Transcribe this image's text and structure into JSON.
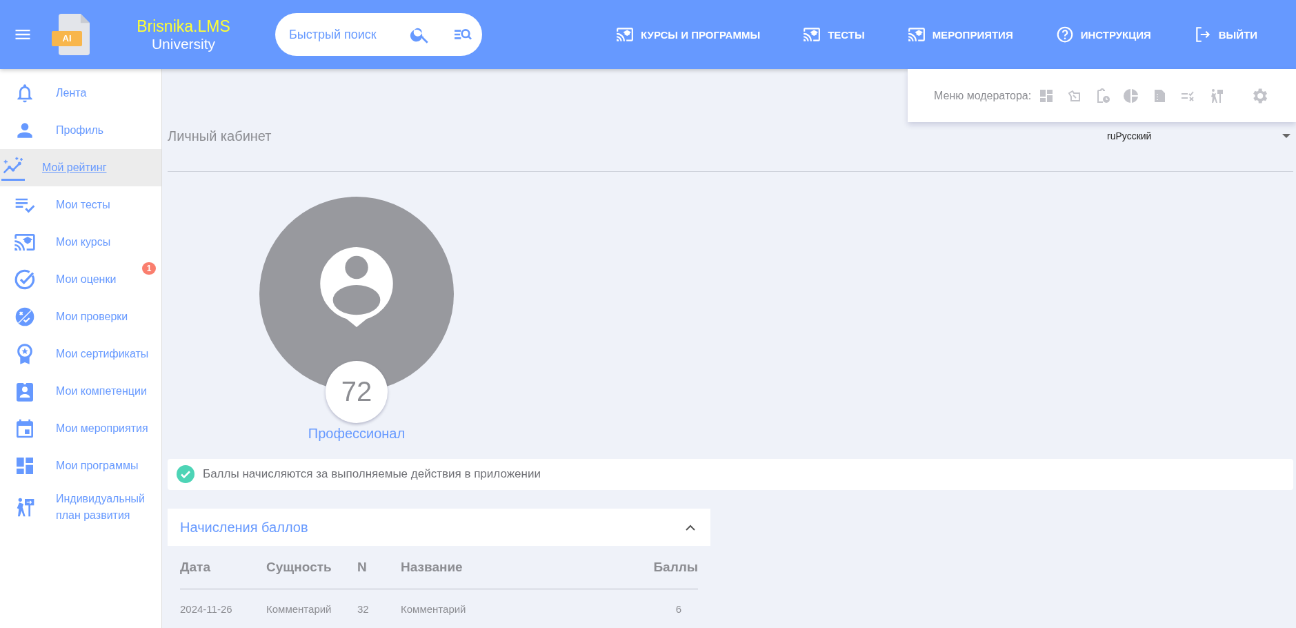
{
  "header": {
    "brand_title": "Brisnika.LMS",
    "brand_subtitle": "University",
    "logo_badge": "AI",
    "search": {
      "placeholder": "Быстрый поиск"
    },
    "nav": [
      {
        "label": "КУРСЫ И ПРОГРАММЫ"
      },
      {
        "label": "ТЕСТЫ"
      },
      {
        "label": "МЕРОПРИЯТИЯ"
      },
      {
        "label": "ИНСТРУКЦИЯ"
      },
      {
        "label": "ВЫЙТИ"
      }
    ]
  },
  "sidebar": {
    "items": [
      {
        "label": "Лента",
        "selected": false
      },
      {
        "label": "Профиль",
        "selected": false
      },
      {
        "label": "Мой рейтинг",
        "selected": true
      },
      {
        "label": "Мои тесты",
        "selected": false
      },
      {
        "label": "Мои курсы",
        "selected": false
      },
      {
        "label": "Мои оценки",
        "selected": false,
        "badge": "1"
      },
      {
        "label": "Мои проверки",
        "selected": false
      },
      {
        "label": "Мои сертификаты",
        "selected": false
      },
      {
        "label": "Мои компетенции",
        "selected": false
      },
      {
        "label": "Мои мероприятия",
        "selected": false
      },
      {
        "label": "Мои программы",
        "selected": false
      },
      {
        "label": "Индивидуальный план развития",
        "selected": false
      }
    ]
  },
  "moderator_menu": {
    "label": "Меню модератора:"
  },
  "page": {
    "title": "Личный кабинет",
    "language": "ruРусский",
    "score": "72",
    "level_name": "Профессионал",
    "info": "Баллы начисляются за выполняемые действия в приложении"
  },
  "points_panel": {
    "title": "Начисления баллов",
    "expanded": true,
    "columns": [
      "Дата",
      "Сущность",
      "N",
      "Название",
      "Баллы"
    ],
    "rows": [
      [
        "2024-11-26",
        "Комментарий",
        "32",
        "Комментарий",
        "6"
      ]
    ]
  }
}
